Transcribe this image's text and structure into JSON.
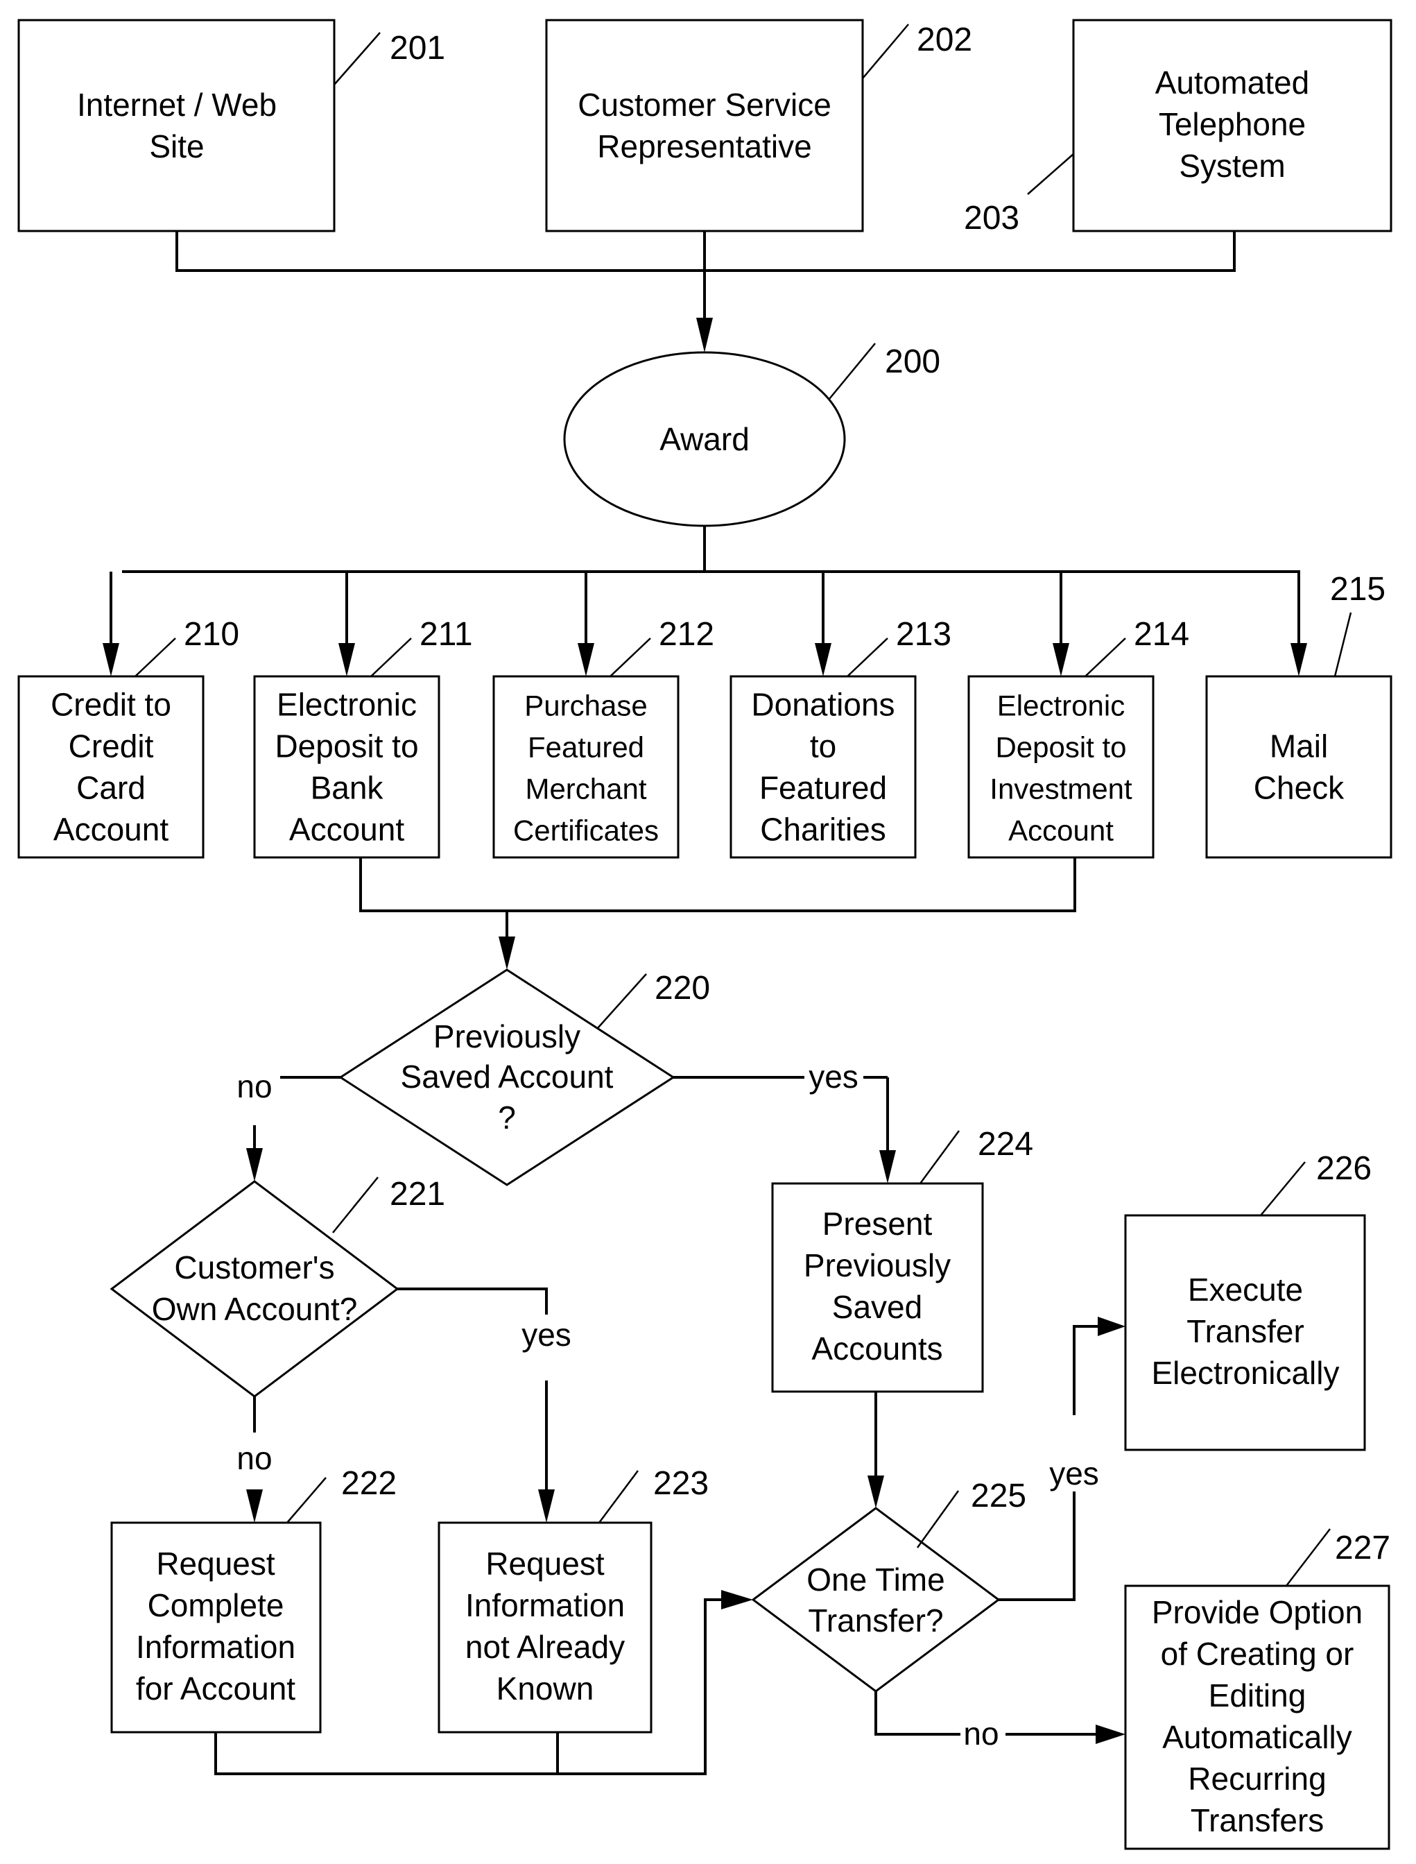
{
  "figure": {
    "sources": [
      {
        "ref": "201",
        "lines": [
          "Internet / Web",
          "Site"
        ]
      },
      {
        "ref": "202",
        "lines": [
          "Customer Service",
          "Representative"
        ]
      },
      {
        "ref": "203",
        "lines": [
          "Automated",
          "Telephone",
          "System"
        ]
      }
    ],
    "award": {
      "ref": "200",
      "label": "Award"
    },
    "options": [
      {
        "ref": "210",
        "lines": [
          "Credit to",
          "Credit",
          "Card",
          "Account"
        ]
      },
      {
        "ref": "211",
        "lines": [
          "Electronic",
          "Deposit to",
          "Bank",
          "Account"
        ]
      },
      {
        "ref": "212",
        "lines": [
          "Purchase",
          "Featured",
          "Merchant",
          "Certificates"
        ]
      },
      {
        "ref": "213",
        "lines": [
          "Donations",
          "to",
          "Featured",
          "Charities"
        ]
      },
      {
        "ref": "214",
        "lines": [
          "Electronic",
          "Deposit to",
          "Investment",
          "Account"
        ]
      },
      {
        "ref": "215",
        "lines": [
          "Mail",
          "Check"
        ]
      }
    ],
    "decision_220": {
      "ref": "220",
      "lines": [
        "Previously",
        "Saved Account",
        "?"
      ]
    },
    "decision_221": {
      "ref": "221",
      "lines": [
        "Customer's",
        "Own Account?"
      ]
    },
    "box_222": {
      "ref": "222",
      "lines": [
        "Request",
        "Complete",
        "Information",
        "for Account"
      ]
    },
    "box_223": {
      "ref": "223",
      "lines": [
        "Request",
        "Information",
        "not Already",
        "Known"
      ]
    },
    "box_224": {
      "ref": "224",
      "lines": [
        "Present",
        "Previously",
        "Saved",
        "Accounts"
      ]
    },
    "decision_225": {
      "ref": "225",
      "lines": [
        "One Time",
        "Transfer?"
      ]
    },
    "box_226": {
      "ref": "226",
      "lines": [
        "Execute",
        "Transfer",
        "Electronically"
      ]
    },
    "box_227": {
      "ref": "227",
      "lines": [
        "Provide Option",
        "of Creating or",
        "Editing",
        "Automatically",
        "Recurring",
        "Transfers"
      ]
    },
    "edge_labels": {
      "d220_no": "no",
      "d220_yes": "yes",
      "d221_no": "no",
      "d221_yes": "yes",
      "d225_yes": "yes",
      "d225_no": "no"
    }
  }
}
